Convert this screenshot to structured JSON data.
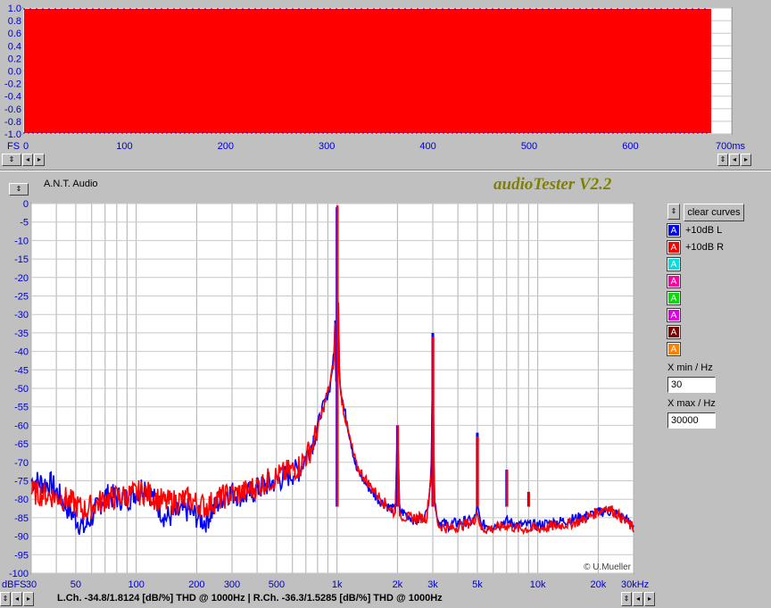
{
  "wave": {
    "y_ticks": [
      "1.0",
      "0.8",
      "0.6",
      "0.4",
      "0.2",
      "0.0",
      "-0.2",
      "-0.4",
      "-0.6",
      "-0.8",
      "-1.0"
    ],
    "x_ticks": [
      "0",
      "100",
      "200",
      "300",
      "400",
      "500",
      "600",
      "700ms"
    ],
    "corner_label": "FS",
    "fill_color": "#ff0000"
  },
  "header": {
    "device": "A.N.T. Audio",
    "app_title": "audioTester V2.2"
  },
  "spectrum": {
    "y_ticks": [
      "0",
      "-5",
      "-10",
      "-15",
      "-20",
      "-25",
      "-30",
      "-35",
      "-40",
      "-45",
      "-50",
      "-55",
      "-60",
      "-65",
      "-70",
      "-75",
      "-80",
      "-85",
      "-90",
      "-95",
      "-100"
    ],
    "x_ticks": [
      "30",
      "50",
      "100",
      "200",
      "300",
      "500",
      "1k",
      "2k",
      "3k",
      "5k",
      "10k",
      "20k",
      "30kHz"
    ],
    "corner_label": "dBFS",
    "watermark": "© U.Mueller"
  },
  "chart_data": {
    "type": "line",
    "xlabel": "",
    "ylabel": "",
    "x_scale": "log",
    "xlim": [
      30,
      30000
    ],
    "ylim": [
      -100,
      0
    ],
    "grid": true,
    "series": [
      {
        "name": "+10dB L",
        "color": "#0000ff",
        "x": [
          30,
          38,
          45,
          55,
          70,
          90,
          110,
          140,
          180,
          220,
          280,
          350,
          450,
          550,
          650,
          750,
          850,
          920,
          970,
          1000,
          1030,
          1080,
          1150,
          1250,
          1400,
          1600,
          1800,
          1950,
          2000,
          2050,
          2200,
          2500,
          2800,
          2950,
          3000,
          3050,
          3200,
          3600,
          4200,
          4800,
          5000,
          5200,
          6000,
          7000,
          8000,
          10000,
          13000,
          16000,
          19000,
          22000,
          25000,
          30000
        ],
        "y": [
          -75,
          -76,
          -82,
          -88,
          -79,
          -80,
          -76,
          -85,
          -83,
          -86,
          -78,
          -79,
          -76,
          -74,
          -72,
          -65,
          -55,
          -50,
          -40,
          -1,
          -48,
          -55,
          -62,
          -72,
          -76,
          -80,
          -82,
          -83,
          -60,
          -83,
          -84,
          -86,
          -84,
          -72,
          -35,
          -80,
          -86,
          -87,
          -86,
          -86,
          -82,
          -87,
          -87,
          -86,
          -87,
          -87,
          -86,
          -85,
          -84,
          -83,
          -84,
          -87
        ]
      },
      {
        "name": "+10dB R",
        "color": "#ff0000",
        "x": [
          30,
          38,
          45,
          55,
          70,
          90,
          110,
          140,
          180,
          220,
          280,
          350,
          450,
          550,
          650,
          750,
          850,
          920,
          970,
          1000,
          1030,
          1080,
          1150,
          1250,
          1400,
          1600,
          1800,
          1950,
          2000,
          2050,
          2200,
          2500,
          2800,
          2950,
          3000,
          3050,
          3200,
          3600,
          4200,
          4800,
          5000,
          5200,
          6000,
          7000,
          8000,
          10000,
          13000,
          16000,
          19000,
          22000,
          25000,
          30000
        ],
        "y": [
          -78,
          -79,
          -80,
          -83,
          -80,
          -79,
          -78,
          -81,
          -80,
          -82,
          -79,
          -78,
          -75,
          -73,
          -71,
          -66,
          -56,
          -49,
          -42,
          -0.5,
          -49,
          -56,
          -63,
          -71,
          -75,
          -79,
          -82,
          -84,
          -60,
          -84,
          -85,
          -85,
          -85,
          -73,
          -36,
          -81,
          -87,
          -88,
          -87,
          -86,
          -83,
          -88,
          -88,
          -87,
          -88,
          -88,
          -87,
          -86,
          -84,
          -82,
          -84,
          -88
        ]
      }
    ],
    "harmonics": [
      {
        "x": 1000,
        "L": -1,
        "R": -0.5
      },
      {
        "x": 2000,
        "L": -60,
        "R": -60
      },
      {
        "x": 3000,
        "L": -35,
        "R": -36
      },
      {
        "x": 5000,
        "L": -62,
        "R": -63
      },
      {
        "x": 7000,
        "L": -72,
        "R": -72
      },
      {
        "x": 9000,
        "L": -78,
        "R": -78
      }
    ]
  },
  "legend": {
    "clear_label": "clear curves",
    "items": [
      {
        "glyph": "A",
        "label": "+10dB L",
        "color": "#0000ff"
      },
      {
        "glyph": "A",
        "label": "+10dB R",
        "color": "#ff0000"
      },
      {
        "glyph": "A",
        "label": "",
        "color": "#00e0e0"
      },
      {
        "glyph": "A",
        "label": "",
        "color": "#ff00a0"
      },
      {
        "glyph": "A",
        "label": "",
        "color": "#00e000"
      },
      {
        "glyph": "A",
        "label": "",
        "color": "#e000e0"
      },
      {
        "glyph": "A",
        "label": "",
        "color": "#800000"
      },
      {
        "glyph": "A",
        "label": "",
        "color": "#ff8000"
      }
    ]
  },
  "controls": {
    "xmin_label": "X min / Hz",
    "xmin_value": "30",
    "xmax_label": "X max / Hz",
    "xmax_value": "30000"
  },
  "status": {
    "text": "L.Ch. -34.8/1.8124 [dB/%] THD @ 1000Hz  | R.Ch. -36.3/1.5285 [dB/%] THD @ 1000Hz"
  }
}
